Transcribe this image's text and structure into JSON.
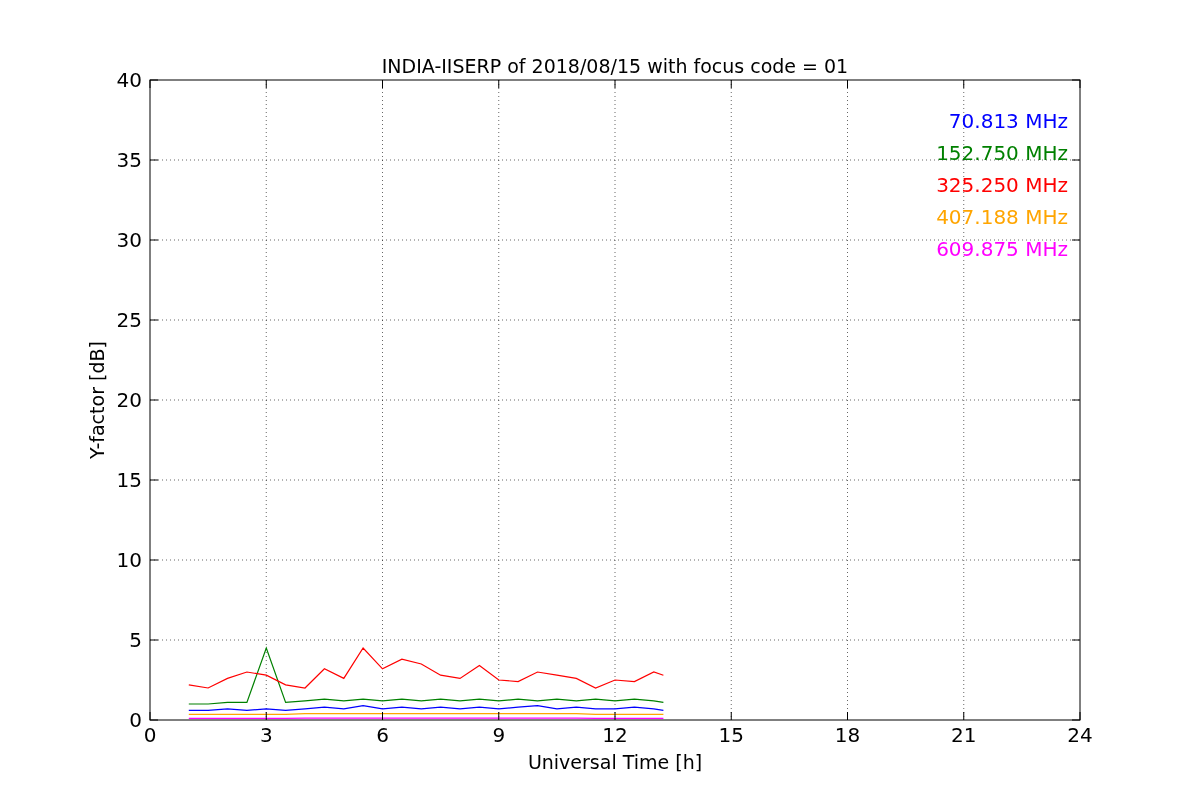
{
  "figure": {
    "chart_data": {
      "type": "line",
      "title": "INDIA-IISERP of 2018/08/15 with focus code = 01",
      "xlabel": "Universal Time [h]",
      "ylabel": "Y-factor [dB]",
      "xlim": [
        0,
        24
      ],
      "ylim": [
        0,
        40
      ],
      "xticks": [
        0,
        3,
        6,
        9,
        12,
        15,
        18,
        21,
        24
      ],
      "yticks": [
        0,
        5,
        10,
        15,
        20,
        25,
        30,
        35,
        40
      ],
      "grid": true,
      "x": [
        1,
        1.5,
        2,
        2.5,
        3,
        3.5,
        4,
        4.5,
        5,
        5.5,
        6,
        6.5,
        7,
        7.5,
        8,
        8.5,
        9,
        9.5,
        10,
        10.5,
        11,
        11.5,
        12,
        12.5,
        13,
        13.25
      ],
      "series": [
        {
          "name": "70.813 MHz",
          "color": "#0000ff",
          "values": [
            0.6,
            0.6,
            0.7,
            0.6,
            0.7,
            0.6,
            0.7,
            0.8,
            0.7,
            0.9,
            0.7,
            0.8,
            0.7,
            0.8,
            0.7,
            0.8,
            0.7,
            0.8,
            0.9,
            0.7,
            0.8,
            0.7,
            0.7,
            0.8,
            0.7,
            0.6
          ]
        },
        {
          "name": "152.750 MHz",
          "color": "#008000",
          "values": [
            1.0,
            1.0,
            1.1,
            1.1,
            4.5,
            1.1,
            1.2,
            1.3,
            1.2,
            1.3,
            1.2,
            1.3,
            1.2,
            1.3,
            1.2,
            1.3,
            1.2,
            1.3,
            1.2,
            1.3,
            1.2,
            1.3,
            1.2,
            1.3,
            1.2,
            1.1
          ]
        },
        {
          "name": "325.250 MHz",
          "color": "#ff0000",
          "values": [
            2.2,
            2.0,
            2.6,
            3.0,
            2.8,
            2.2,
            2.0,
            3.2,
            2.6,
            4.5,
            3.2,
            3.8,
            3.5,
            2.8,
            2.6,
            3.4,
            2.5,
            2.4,
            3.0,
            2.8,
            2.6,
            2.0,
            2.5,
            2.4,
            3.0,
            2.8
          ]
        },
        {
          "name": "407.188 MHz",
          "color": "#ffa500",
          "values": [
            0.35,
            0.35,
            0.35,
            0.35,
            0.35,
            0.35,
            0.4,
            0.4,
            0.4,
            0.4,
            0.4,
            0.4,
            0.4,
            0.4,
            0.4,
            0.4,
            0.4,
            0.4,
            0.4,
            0.4,
            0.4,
            0.35,
            0.35,
            0.35,
            0.35,
            0.35
          ]
        },
        {
          "name": "609.875 MHz",
          "color": "#ff00ff",
          "values": [
            0.1,
            0.1,
            0.1,
            0.1,
            0.1,
            0.1,
            0.12,
            0.12,
            0.12,
            0.12,
            0.12,
            0.12,
            0.12,
            0.12,
            0.12,
            0.12,
            0.12,
            0.12,
            0.12,
            0.12,
            0.12,
            0.1,
            0.1,
            0.1,
            0.1,
            0.1
          ]
        }
      ]
    }
  }
}
